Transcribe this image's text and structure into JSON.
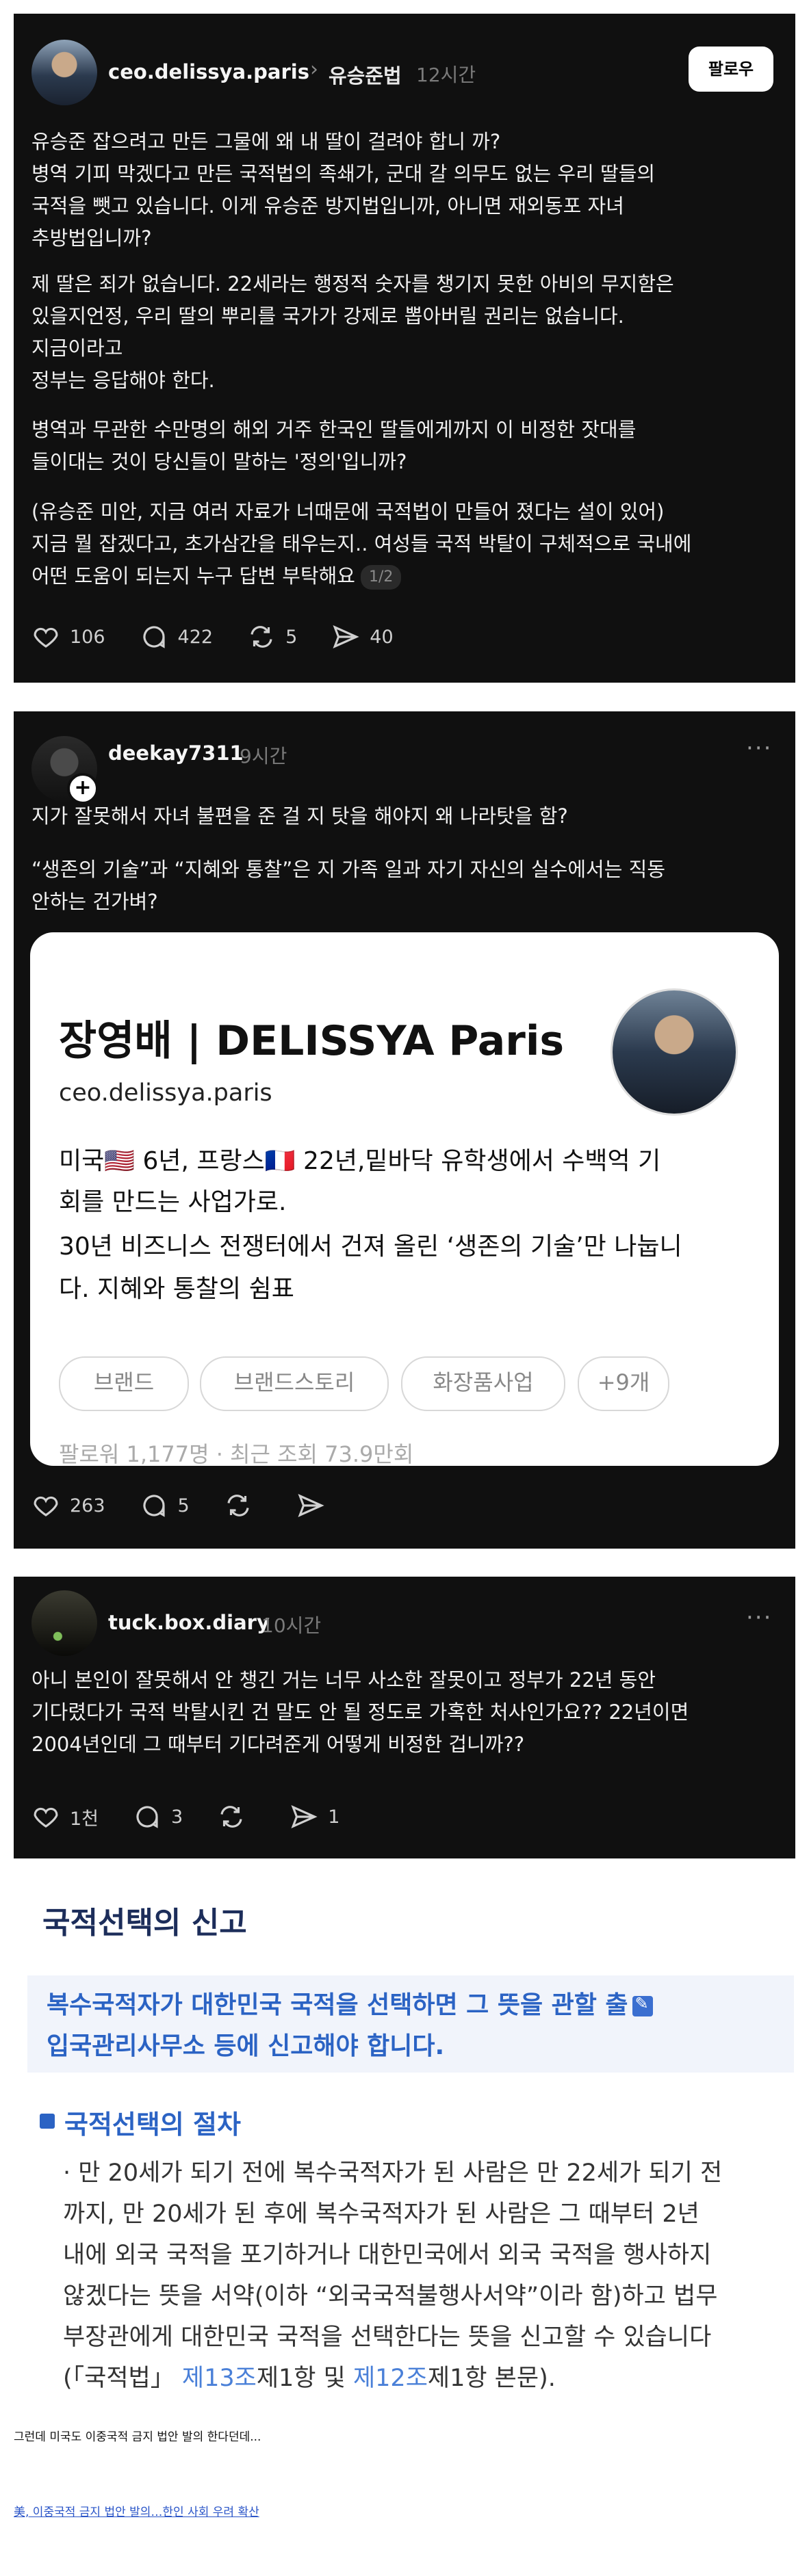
{
  "post1": {
    "username": "ceo.delissya.paris",
    "topic": "유승준법",
    "time": "12시간",
    "follow_label": "팔로우",
    "lines": [
      "유승준 잡으려고 만든 그물에 왜 내 딸이 걸려야 합니 까?",
      "병역 기피 막겠다고 만든 국적법의 족쇄가, 군대 갈 의무도 없는 우리 딸들의",
      "국적을 뺏고 있습니다. 이게 유승준 방지법입니까, 아니면 재외동포 자녀",
      "추방법입니까?",
      "제 딸은 죄가 없습니다. 22세라는 행정적 숫자를 챙기지 못한 아비의 무지함은",
      "있을지언정, 우리 딸의 뿌리를 국가가 강제로 뽑아버릴 권리는 없습니다.",
      "지금이라고",
      "정부는 응답해야 한다.",
      "병역과 무관한 수만명의 해외 거주 한국인 딸들에게까지 이 비정한 잣대를",
      "들이대는 것이 당신들이 말하는 '정의'입니까?",
      "(유승준 미안, 지금 여러 자료가 너때문에 국적법이 만들어 졌다는 설이 있어)",
      "지금 뭘 잡겠다고, 초가삼간을 태우는지.. 여성들 국적 박탈이 구체적으로 국내에",
      "어떤 도움이 되는지 누구 답변 부탁해요"
    ],
    "pager": "1/2",
    "likes": "106",
    "comments": "422",
    "reposts": "5",
    "shares": "40"
  },
  "post2": {
    "username": "deekay7311",
    "time": "9시간",
    "lines": [
      "지가 잘못해서 자녀 불편을 준 걸 지 탓을 해야지 왜 나라탓을 함?",
      "“생존의 기술”과 “지혜와 통찰”은 지 가족 일과 자기 자신의 실수에서는 직동",
      "안하는 건가벼?"
    ],
    "profile_card": {
      "name": "장영배 | DELISSYA Paris",
      "handle": "ceo.delissya.paris",
      "bio": [
        "미국🇺🇸 6년, 프랑스🇫🇷 22년,밑바닥 유학생에서 수백억 기",
        "회를 만드는 사업가로.",
        "30년 비즈니스 전쟁터에서 건져 올린 ‘생존의 기술’만 나눕니",
        "다. 지혜와 통찰의 쉼표"
      ],
      "chips": [
        "브랜드",
        "브랜드스토리",
        "화장품사업",
        "+9개"
      ],
      "stats": "팔로워 1,177명 · 최근 조회 73.9만회"
    },
    "likes": "263",
    "comments": "5"
  },
  "post3": {
    "username": "tuck.box.diary",
    "time": "10시간",
    "lines": [
      "아니 본인이 잘못해서 안 챙긴 거는 너무 사소한 잘못이고 정부가 22년 동안",
      "기다렸다가 국적 박탈시킨 건 말도 안 될 정도로 가혹한 처사인가요?? 22년이면",
      "2004년인데 그 때부터 기다려준게 어떻게 비정한 겁니까??"
    ],
    "likes": "1천",
    "comments": "3",
    "shares": "1"
  },
  "doc": {
    "title": "국적선택의 신고",
    "box_lines": [
      "복수국적자가 대한민국 국적을 선택하면 그 뜻을 관할 출",
      "입국관리사무소 등에 신고해야 합니다."
    ],
    "subtitle": "국적선택의 절차",
    "lines": [
      "· 만 20세가 되기 전에 복수국적자가 된 사람은 만 22세가 되기 전",
      "까지, 만 20세가 된 후에 복수국적자가 된 사람은 그 때부터 2년",
      "내에 외국 국적을 포기하거나 대한민국에서 외국 국적을 행사하지",
      "않겠다는 뜻을 서약(이하 “외국국적불행사서약”이라 함)하고 법무",
      "부장관에게 대한민국 국적을 선택한다는 뜻을 신고할 수 있습니다"
    ],
    "last_line": {
      "pre": "(「국적법」 ",
      "link1": "제13조",
      "mid": "제1항 및 ",
      "link2": "제12조",
      "post": "제1항 본문)."
    }
  },
  "footer": {
    "caption": "그런데 미국도 이중국적 금지 법안 발의 한다던데...",
    "link": "美, 이중국적 금지 법안 발의…한인 사회 우려 확산"
  }
}
